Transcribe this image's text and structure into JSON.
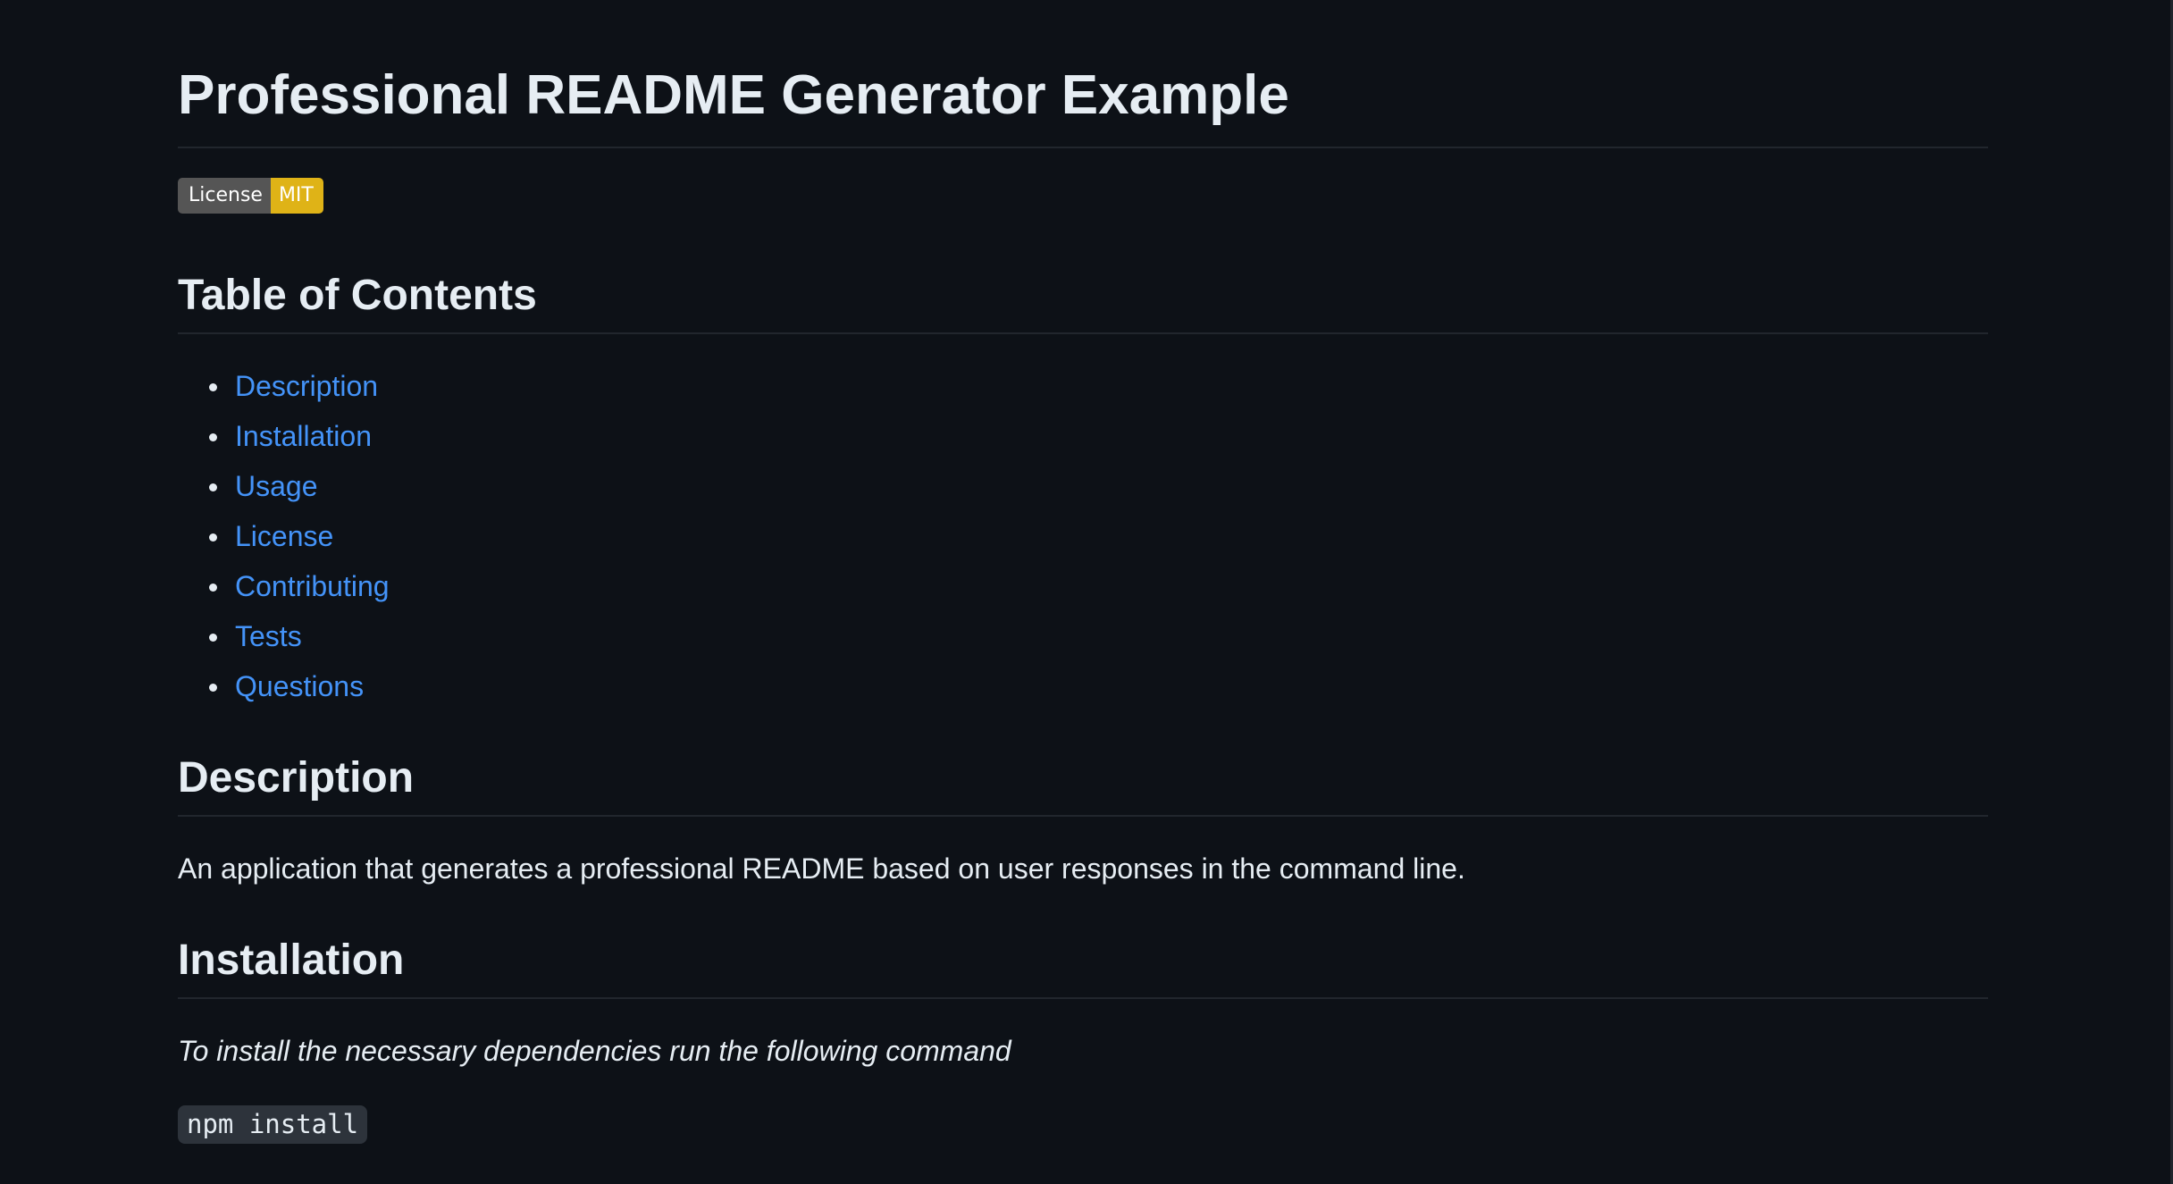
{
  "document": {
    "title": "Professional README Generator Example",
    "badge": {
      "label": "License",
      "value": "MIT",
      "label_color": "#555555",
      "value_color": "#dfb317"
    },
    "toc": {
      "heading": "Table of Contents",
      "items": [
        "Description",
        "Installation",
        "Usage",
        "License",
        "Contributing",
        "Tests",
        "Questions"
      ]
    },
    "description": {
      "heading": "Description",
      "text": "An application that generates a professional README based on user responses in the command line."
    },
    "installation": {
      "heading": "Installation",
      "text": "To install the necessary dependencies run the following command",
      "command": "npm install"
    }
  },
  "colors": {
    "background": "#0d1117",
    "text": "#e6edf3",
    "link": "#4493f8",
    "divider": "#21262d",
    "code_background": "#2d333b"
  }
}
